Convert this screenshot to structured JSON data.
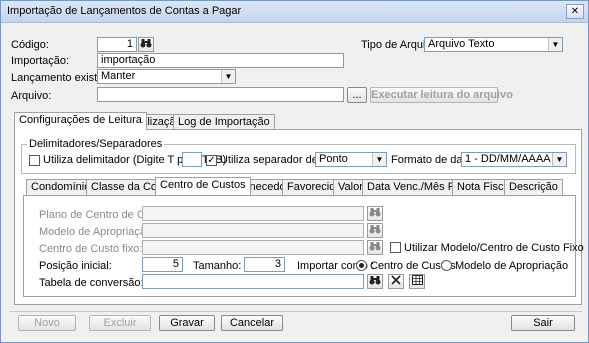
{
  "window": {
    "title": "Importação de Lançamentos de Contas a Pagar",
    "close": "✕"
  },
  "form": {
    "codigo_label": "Código:",
    "codigo_value": "1",
    "tipo_label": "Tipo de Arquivo:",
    "tipo_value": "Arquivo Texto",
    "importacao_label": "Importação:",
    "importacao_value": "importação",
    "lancamento_label": "Lançamento existente:",
    "lancamento_value": "Manter",
    "arquivo_label": "Arquivo:",
    "arquivo_value": "",
    "browse_label": "...",
    "executar_label": "Executar leitura do arquivo"
  },
  "main_tabs": [
    "Configurações de Leitura",
    "Visualização",
    "Log de Importação"
  ],
  "delim": {
    "group_label": "Delimitadores/Separadores",
    "utiliza_delim_label": "Utiliza delimitador (Digite T para TAB)",
    "utiliza_delim_checked": false,
    "utiliza_sep_label": "Utiliza separador decimal",
    "utiliza_sep_checked": true,
    "sep_value": "Ponto",
    "formato_label": "Formato de data:",
    "formato_value": "1 - DD/MM/AAAA"
  },
  "sub_tabs": [
    "Condomínios",
    "Classe da Conta",
    "Centro de Custos",
    "Fornecedor",
    "Favorecido",
    "Valor",
    "Data Venc./Mês Ref.",
    "Nota Fiscal",
    "Descrição"
  ],
  "cc": {
    "plano_label": "Plano de Centro de Custos:",
    "modelo_label": "Modelo de Apropriação:",
    "fixo_label": "Centro de Custo fixo:",
    "utilizar_modelo_label": "Utilizar Modelo/Centro de Custo Fixo",
    "posicao_label": "Posição inicial:",
    "posicao_value": "5",
    "tamanho_label": "Tamanho:",
    "tamanho_value": "3",
    "importar_label": "Importar como :",
    "radio_cc_label": "Centro de Custos",
    "radio_modelo_label": "Modelo de Apropriação",
    "tabela_label": "Tabela de conversão:"
  },
  "footer": {
    "novo": "Novo",
    "excluir": "Excluir",
    "gravar": "Gravar",
    "cancelar": "Cancelar",
    "sair": "Sair"
  },
  "icons": {
    "binoculars": "binoculars-icon",
    "delete": "x-icon",
    "grid": "table-icon"
  }
}
